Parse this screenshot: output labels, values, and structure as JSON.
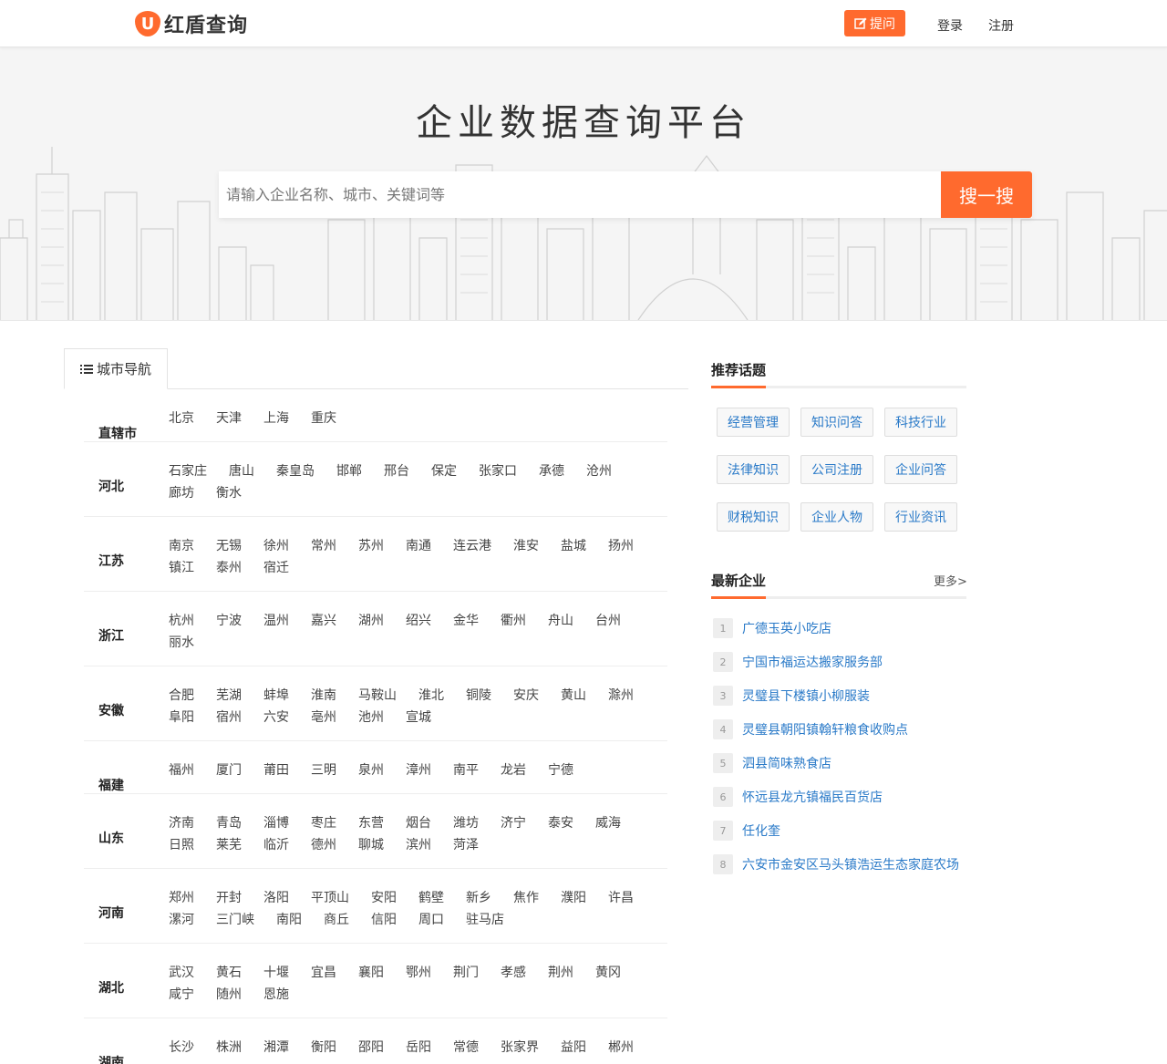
{
  "header": {
    "logo_letter": "U",
    "logo_text": "红盾查询",
    "ask_label": "提问",
    "login_label": "登录",
    "register_label": "注册",
    "accent_color": "#ff6a2e"
  },
  "hero": {
    "title": "企业数据查询平台",
    "search_placeholder": "请输入企业名称、城市、关键词等",
    "search_button": "搜一搜"
  },
  "city_nav": {
    "tab_label": "城市导航",
    "provinces": [
      {
        "name": "直辖市",
        "cities": [
          "北京",
          "天津",
          "上海",
          "重庆"
        ]
      },
      {
        "name": "河北",
        "cities": [
          "石家庄",
          "唐山",
          "秦皇岛",
          "邯郸",
          "邢台",
          "保定",
          "张家口",
          "承德",
          "沧州",
          "廊坊",
          "衡水"
        ]
      },
      {
        "name": "江苏",
        "cities": [
          "南京",
          "无锡",
          "徐州",
          "常州",
          "苏州",
          "南通",
          "连云港",
          "淮安",
          "盐城",
          "扬州",
          "镇江",
          "泰州",
          "宿迁"
        ]
      },
      {
        "name": "浙江",
        "cities": [
          "杭州",
          "宁波",
          "温州",
          "嘉兴",
          "湖州",
          "绍兴",
          "金华",
          "衢州",
          "舟山",
          "台州",
          "丽水"
        ]
      },
      {
        "name": "安徽",
        "cities": [
          "合肥",
          "芜湖",
          "蚌埠",
          "淮南",
          "马鞍山",
          "淮北",
          "铜陵",
          "安庆",
          "黄山",
          "滁州",
          "阜阳",
          "宿州",
          "六安",
          "亳州",
          "池州",
          "宣城"
        ]
      },
      {
        "name": "福建",
        "cities": [
          "福州",
          "厦门",
          "莆田",
          "三明",
          "泉州",
          "漳州",
          "南平",
          "龙岩",
          "宁德"
        ]
      },
      {
        "name": "山东",
        "cities": [
          "济南",
          "青岛",
          "淄博",
          "枣庄",
          "东营",
          "烟台",
          "潍坊",
          "济宁",
          "泰安",
          "威海",
          "日照",
          "莱芜",
          "临沂",
          "德州",
          "聊城",
          "滨州",
          "菏泽"
        ]
      },
      {
        "name": "河南",
        "cities": [
          "郑州",
          "开封",
          "洛阳",
          "平顶山",
          "安阳",
          "鹤壁",
          "新乡",
          "焦作",
          "濮阳",
          "许昌",
          "漯河",
          "三门峡",
          "南阳",
          "商丘",
          "信阳",
          "周口",
          "驻马店"
        ]
      },
      {
        "name": "湖北",
        "cities": [
          "武汉",
          "黄石",
          "十堰",
          "宜昌",
          "襄阳",
          "鄂州",
          "荆门",
          "孝感",
          "荆州",
          "黄冈",
          "咸宁",
          "随州",
          "恩施"
        ]
      },
      {
        "name": "湖南",
        "cities": [
          "长沙",
          "株洲",
          "湘潭",
          "衡阳",
          "邵阳",
          "岳阳",
          "常德",
          "张家界",
          "益阳",
          "郴州"
        ]
      }
    ]
  },
  "sidebar": {
    "topics_title": "推荐话题",
    "topics": [
      "经营管理",
      "知识问答",
      "科技行业",
      "法律知识",
      "公司注册",
      "企业问答",
      "财税知识",
      "企业人物",
      "行业资讯"
    ],
    "latest_title": "最新企业",
    "more_label": "更多>",
    "enterprises": [
      {
        "num": "1",
        "name": "广德玉英小吃店"
      },
      {
        "num": "2",
        "name": "宁国市福运达搬家服务部"
      },
      {
        "num": "3",
        "name": "灵璧县下楼镇小柳服装"
      },
      {
        "num": "4",
        "name": "灵璧县朝阳镇翰轩粮食收购点"
      },
      {
        "num": "5",
        "name": "泗县简味熟食店"
      },
      {
        "num": "6",
        "name": "怀远县龙亢镇福民百货店"
      },
      {
        "num": "7",
        "name": "任化奎"
      },
      {
        "num": "8",
        "name": "六安市金安区马头镇浩运生态家庭农场"
      }
    ]
  }
}
